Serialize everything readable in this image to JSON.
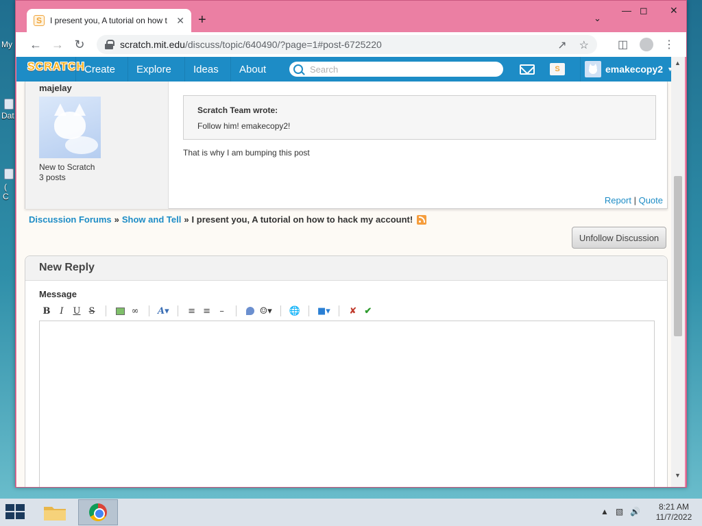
{
  "desktop": {
    "icon_label_1": "My",
    "icon_label_2": "Dat",
    "icon_label_3": "(",
    "icon_label_4": "C"
  },
  "browser": {
    "tab_title": "I present you, A tutorial on how t",
    "tab_favicon": "S",
    "url_host": "scratch.mit.edu",
    "url_path": "/discuss/topic/640490/?page=1#post-6725220"
  },
  "scratch_nav": {
    "logo": "SCRATCH",
    "items": [
      "Create",
      "Explore",
      "Ideas",
      "About"
    ],
    "search_placeholder": "Search",
    "username": "emakecopy2",
    "folder_badge": "S"
  },
  "post": {
    "username": "majelay",
    "rank": "New to Scratch",
    "posts": "3 posts",
    "quote_author": "Scratch Team wrote:",
    "quote_text": "Follow him! emakecopy2!",
    "body": "That is why I am bumping this post",
    "report_label": "Report",
    "separator": "|",
    "quote_label": "Quote"
  },
  "breadcrumb": {
    "forums": "Discussion Forums",
    "sep": "»",
    "section": "Show and Tell",
    "topic": "I present you, A tutorial on how to hack my account!"
  },
  "unfollow_label": "Unfollow Discussion",
  "reply": {
    "title": "New Reply",
    "message_label": "Message"
  },
  "taskbar": {
    "time": "8:21 AM",
    "date": "11/7/2022"
  },
  "colors": {
    "window_frame": "#eb7fa3",
    "scratch_blue": "#1d8cc6",
    "scratch_orange": "#f8b322"
  }
}
